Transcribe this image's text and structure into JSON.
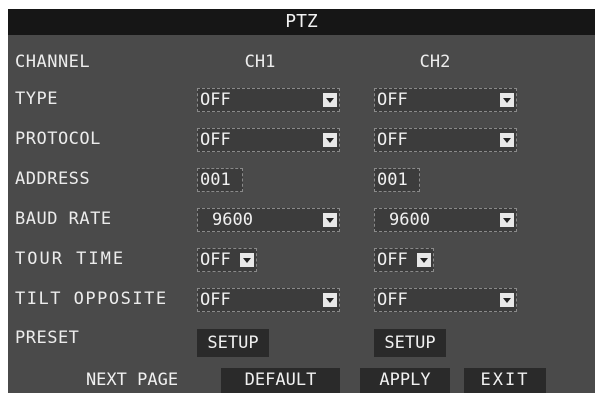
{
  "window": {
    "title": "PTZ"
  },
  "columns": {
    "ch1": "CH1",
    "ch2": "CH2"
  },
  "labels": {
    "channel": "CHANNEL",
    "type": "TYPE",
    "protocol": "PROTOCOL",
    "address": "ADDRESS",
    "baud_rate": "BAUD RATE",
    "tour_time": "TOUR TIME",
    "tilt_opposite": "TILT OPPOSITE",
    "preset": "PRESET"
  },
  "ch1": {
    "type": "OFF",
    "protocol": "OFF",
    "address": "001",
    "baud_rate": "9600",
    "tour_time": "OFF",
    "tilt_opposite": "OFF",
    "preset_button": "SETUP"
  },
  "ch2": {
    "type": "OFF",
    "protocol": "OFF",
    "address": "001",
    "baud_rate": "9600",
    "tour_time": "OFF",
    "tilt_opposite": "OFF",
    "preset_button": "SETUP"
  },
  "footer": {
    "next_page": "NEXT PAGE",
    "default": "DEFAULT",
    "apply": "APPLY",
    "exit": "EXIT"
  }
}
